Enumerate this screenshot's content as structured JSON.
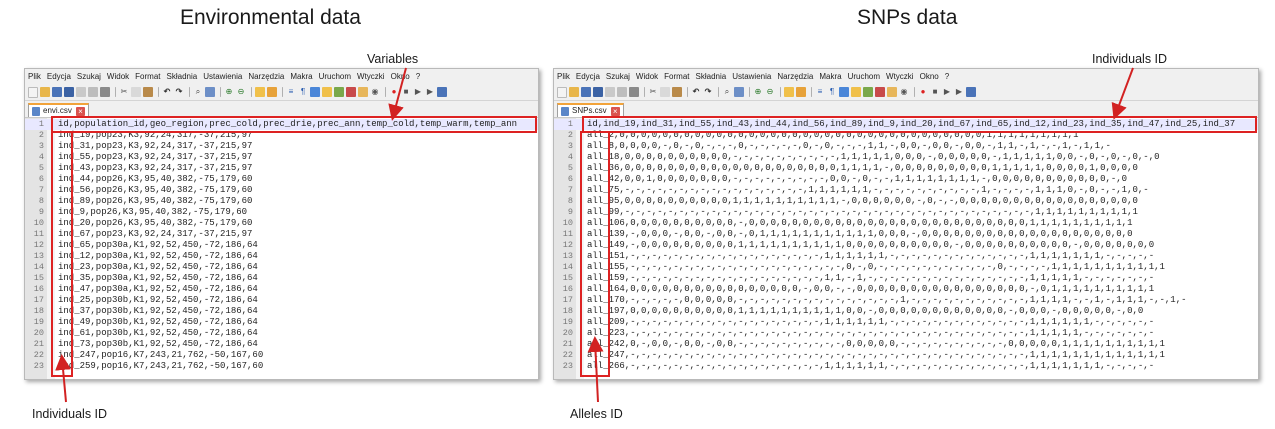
{
  "headings": {
    "left": "Environmental data",
    "right": "SNPs data"
  },
  "callouts": {
    "variables": "Variables",
    "individuals_top": "Individuals ID",
    "individuals_bottom": "Individuals ID",
    "alleles": "Alleles ID"
  },
  "menu": [
    "Plik",
    "Edycja",
    "Szukaj",
    "Widok",
    "Format",
    "Składnia",
    "Ustawienia",
    "Narzędzia",
    "Makra",
    "Uruchom",
    "Wtyczki",
    "Okno",
    "?"
  ],
  "left_editor": {
    "tab_label": "envi.csv",
    "line_numbers": [
      "1",
      "2",
      "3",
      "4",
      "5",
      "6",
      "7",
      "8",
      "9",
      "10",
      "11",
      "12",
      "13",
      "14",
      "15",
      "16",
      "17",
      "18",
      "19",
      "20",
      "21",
      "22",
      "23"
    ],
    "lines": [
      "id,population_id,geo_region,prec_cold,prec_drie,prec_ann,temp_cold,temp_warm,temp_ann",
      "ind_19,pop23,K3,92,24,317,-37,215,97",
      "ind_31,pop23,K3,92,24,317,-37,215,97",
      "ind_55,pop23,K3,92,24,317,-37,215,97",
      "ind_43,pop23,K3,92,24,317,-37,215,97",
      "ind_44,pop26,K3,95,40,382,-75,179,60",
      "ind_56,pop26,K3,95,40,382,-75,179,60",
      "ind_89,pop26,K3,95,40,382,-75,179,60",
      "ind_9,pop26,K3,95,40,382,-75,179,60",
      "ind_20,pop26,K3,95,40,382,-75,179,60",
      "ind_67,pop23,K3,92,24,317,-37,215,97",
      "ind_65,pop30a,K1,92,52,450,-72,186,64",
      "ind_12,pop30a,K1,92,52,450,-72,186,64",
      "ind_23,pop30a,K1,92,52,450,-72,186,64",
      "ind_35,pop30a,K1,92,52,450,-72,186,64",
      "ind_47,pop30a,K1,92,52,450,-72,186,64",
      "ind_25,pop30b,K1,92,52,450,-72,186,64",
      "ind_37,pop30b,K1,92,52,450,-72,186,64",
      "ind_49,pop30b,K1,92,52,450,-72,186,64",
      "ind_61,pop30b,K1,92,52,450,-72,186,64",
      "ind_73,pop30b,K1,92,52,450,-72,186,64",
      "ind_247,pop16,K7,243,21,762,-50,167,60",
      "ind_259,pop16,K7,243,21,762,-50,167,60"
    ]
  },
  "right_editor": {
    "tab_label": "SNPs.csv",
    "line_numbers": [
      "1",
      "2",
      "3",
      "4",
      "5",
      "6",
      "7",
      "8",
      "9",
      "10",
      "11",
      "12",
      "13",
      "14",
      "15",
      "16",
      "17",
      "18",
      "19",
      "20",
      "21",
      "22",
      "23"
    ],
    "lines": [
      "id,ind_19,ind_31,ind_55,ind_43,ind_44,ind_56,ind_89,ind_9,ind_20,ind_67,ind_65,ind_12,ind_23,ind_35,ind_47,ind_25,ind_37",
      "all_2,0,0,0,0,0,0,0,0,0,0,0,0,0,0,0,0,0,0,0,0,0,0,0,0,0,0,0,0,0,0,0,0,0,0,1,1,1,1,1,1,1,1,1",
      "all_8,0,0,0,0,-,0,-,0,-,-,-,0,-,-,-,-,-,0,-,0,-,-,-,1,1,-,0,0,-,0,0,-,0,0,-,1,1,-,1,-,-,1,-,1,1,-",
      "all_18,0,0,0,0,0,0,0,0,0,0,-,-,-,-,-,-,-,-,-,-,1,1,1,1,1,0,0,0,-,0,0,0,0,0,-,1,1,1,1,1,0,0,-,0,-,0,-,0,-,0",
      "all_36,0,0,0,0,0,0,0,0,0,0,0,0,0,0,0,0,0,0,0,0,1,1,1,1,-,0,0,0,0,0,0,0,0,0,1,1,1,1,1,0,0,0,0,1,0,0,0,0",
      "all_42,0,0,1,0,0,0,0,0,0,0,-,-,-,-,-,-,-,-,-,0,0,-,0,-,-,1,1,1,1,1,1,1,1,-,0,0,0,0,0,0,0,0,0,0,0,-,0",
      "all_75,-,-,-,-,-,-,-,-,-,-,-,-,-,-,-,-,-,1,1,1,1,1,1,-,-,-,-,-,-,-,-,-,-,1,-,-,-,-,1,1,1,0,-,0,-,-,1,0,-",
      "all_95,0,0,0,0,0,0,0,0,0,0,1,1,1,1,1,1,1,1,1,1,-,0,0,0,0,0,0,-,0,-,-,0,0,0,0,0,0,0,0,0,0,0,0,0,0,0,0,0",
      "all_99,-,-,-,-,-,-,-,-,-,-,-,-,-,-,-,-,-,-,-,-,-,-,-,-,-,-,-,-,-,-,-,-,-,-,-,-,-,-,1,1,1,1,1,1,1,1,1,1",
      "all_106,0,0,0,0,0,0,0,0,0,0,-,0,0,0,0,0,0,0,0,0,0,0,0,0,0,0,0,0,0,0,0,0,0,0,0,0,0,1,1,1,1,1,1,1,1,1,1",
      "all_139,-,0,0,0,-,0,0,-,0,0,-,0,1,1,1,1,1,1,1,1,1,1,1,0,0,0,-,0,0,0,0,0,0,0,0,0,0,0,0,0,0,0,0,0,0,0,0",
      "all_149,-,0,0,0,0,0,0,0,0,0,1,1,1,1,1,1,1,1,1,1,0,0,0,0,0,0,0,0,0,0,-,0,0,0,0,0,0,0,0,0,0,-,0,0,0,0,0,0,0",
      "all_151,-,-,-,-,-,-,-,-,-,-,-,-,-,-,-,-,-,-,1,1,1,1,1,1,-,-,-,-,-,-,-,-,-,-,-,-,-,1,1,1,1,1,1,1,-,-,-,-,-",
      "all_155,-,-,-,-,-,-,-,-,-,-,-,-,-,-,-,-,-,-,-,-,0,-,0,-,-,-,-,-,-,-,-,-,-,-,0,-,-,-,-,1,1,1,1,1,1,1,1,1,1,1",
      "all_159,-,-,-,-,-,-,-,-,-,-,-,-,-,-,-,-,-,-,1,1,-,1,-,-,-,-,-,-,-,-,-,-,-,-,-,-,-,1,1,1,1,1,-,-,-,-,-,-,-",
      "all_164,0,0,0,0,0,0,0,0,0,0,0,0,0,0,0,0,-,0,0,-,-,0,0,0,0,0,0,0,0,0,0,0,0,0,0,0,0,-,0,1,1,1,1,1,1,1,1,1,1",
      "all_170,-,-,-,-,-,0,0,0,0,0,-,-,-,-,-,-,-,-,-,-,-,-,-,-,-,1,-,-,-,-,-,-,-,-,-,-,-,1,1,1,1,-,-,1,-,1,1,1,-,-,1,-",
      "all_197,0,0,0,0,0,0,0,0,0,0,1,1,1,1,1,1,1,1,1,1,0,0,-,0,0,0,0,0,0,0,0,0,0,0,0,-,0,0,0,-,0,0,0,0,0,-,0,0",
      "all_209,-,-,-,-,-,-,-,-,-,-,-,-,-,-,-,-,-,-,1,1,1,1,1,1,-,-,-,-,-,-,-,-,-,-,-,-,-,1,1,1,1,1,1,-,-,-,-,-,-",
      "all_223,-,-,-,-,-,-,-,-,-,-,-,-,-,-,-,-,-,-,-,-,-,-,-,-,-,-,-,-,-,-,-,-,-,-,-,-,-,1,1,1,1,1,-,-,-,-,-,-,-",
      "all_242,0,-,0,0,-,0,0,-,0,0,-,-,-,-,-,-,-,-,-,-,0,0,0,0,0,-,-,-,-,-,-,-,-,-,-,0,0,0,0,0,1,1,1,1,1,1,1,1,1,1",
      "all_247,-,-,-,-,-,-,-,-,-,-,-,-,-,-,-,-,-,-,-,-,-,-,-,-,-,-,-,-,-,-,-,-,-,-,-,-,-,1,1,1,1,1,1,1,1,1,1,1,1,1",
      "all_266,-,-,-,-,-,-,-,-,-,-,-,-,-,-,-,-,-,-,1,1,1,1,1,1,-,-,-,-,-,-,-,-,-,-,-,-,-,1,1,1,1,1,1,1,-,-,-,-,-"
    ]
  },
  "colors": {
    "highlight": "#d22222",
    "tab_accent": "#f2a33a",
    "selected_line": "#e8e8ff"
  }
}
